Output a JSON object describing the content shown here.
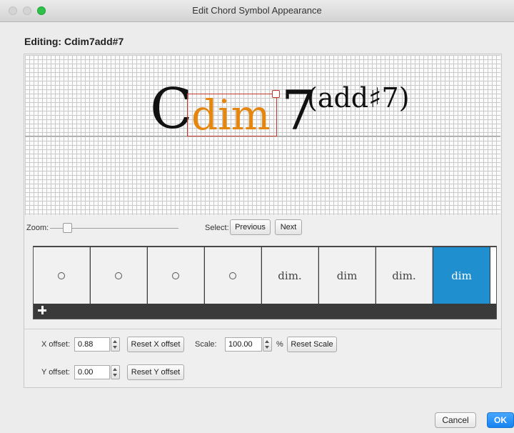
{
  "window": {
    "title": "Edit Chord Symbol Appearance"
  },
  "editing": {
    "label": "Editing:  Cdim7add#7"
  },
  "canvas": {
    "chord_root": "C",
    "chord_quality": "dim",
    "chord_seventh": "7",
    "chord_addition": "(add♯7)"
  },
  "controls": {
    "zoom_label": "Zoom:",
    "select_label": "Select:",
    "previous_label": "Previous",
    "next_label": "Next"
  },
  "variants": [
    {
      "label": "",
      "kind": "circle"
    },
    {
      "label": "",
      "kind": "circle"
    },
    {
      "label": "",
      "kind": "circle"
    },
    {
      "label": "",
      "kind": "circle"
    },
    {
      "label": "dim.",
      "kind": "text"
    },
    {
      "label": "dim",
      "kind": "text"
    },
    {
      "label": "dim.",
      "kind": "text"
    },
    {
      "label": "dim",
      "kind": "text",
      "selected": true
    }
  ],
  "offsets": {
    "x_label": "X offset:",
    "x_value": "0.88",
    "reset_x_label": "Reset X offset",
    "y_label": "Y offset:",
    "y_value": "0.00",
    "reset_y_label": "Reset Y offset",
    "scale_label": "Scale:",
    "scale_value": "100.00",
    "scale_unit": "%",
    "reset_scale_label": "Reset Scale"
  },
  "footer": {
    "cancel_label": "Cancel",
    "ok_label": "OK"
  },
  "colors": {
    "accent": "#1f8fcf",
    "selection": "#c0392b",
    "highlight": "#e5860f"
  }
}
